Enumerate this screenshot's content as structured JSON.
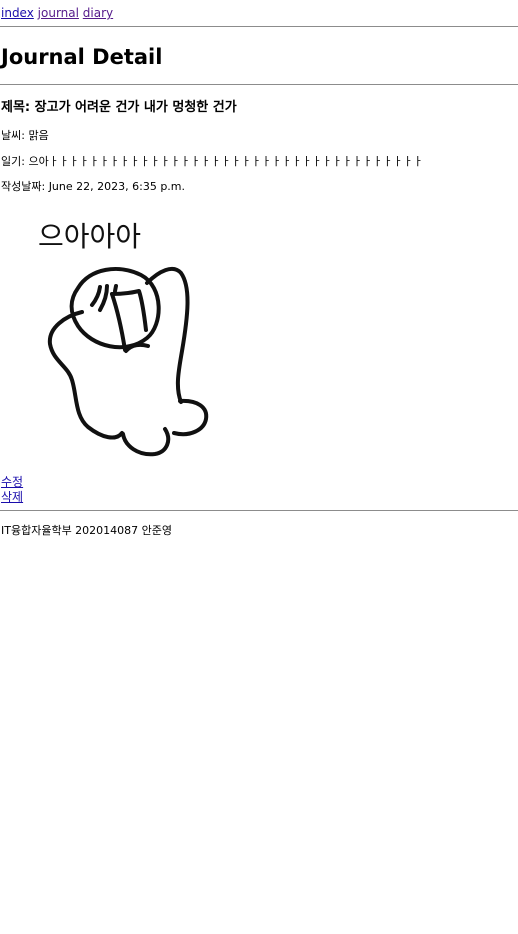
{
  "nav": {
    "links": [
      "index",
      "journal",
      "diary"
    ]
  },
  "page": {
    "title": "Journal Detail"
  },
  "entry": {
    "title_label": "제목:",
    "title": "장고가 어려운 건가 내가 멍청한 건가",
    "weather_label": "날씨:",
    "weather": "맑음",
    "diary_label": "일기:",
    "diary": "으아ㅏㅏㅏㅏㅏㅏㅏㅏㅏㅏㅏㅏㅏㅏㅏㅏㅏㅏㅏㅏㅏㅏㅏㅏㅏㅏㅏㅏㅏㅏㅏㅏㅏㅏㅏㅏㅏ",
    "date_label": "작성날짜:",
    "date": "June 22, 2023, 6:35 p.m.",
    "image_text": "으아아아"
  },
  "actions": {
    "edit": "수정",
    "delete": "삭제"
  },
  "footer": {
    "text": "IT융합자율학부 202014087 안준영"
  },
  "colors": {
    "link": "#1a0dab",
    "visited_link": "#551a8b",
    "rule": "#8c8c8c",
    "text": "#000000",
    "background": "#ffffff"
  }
}
